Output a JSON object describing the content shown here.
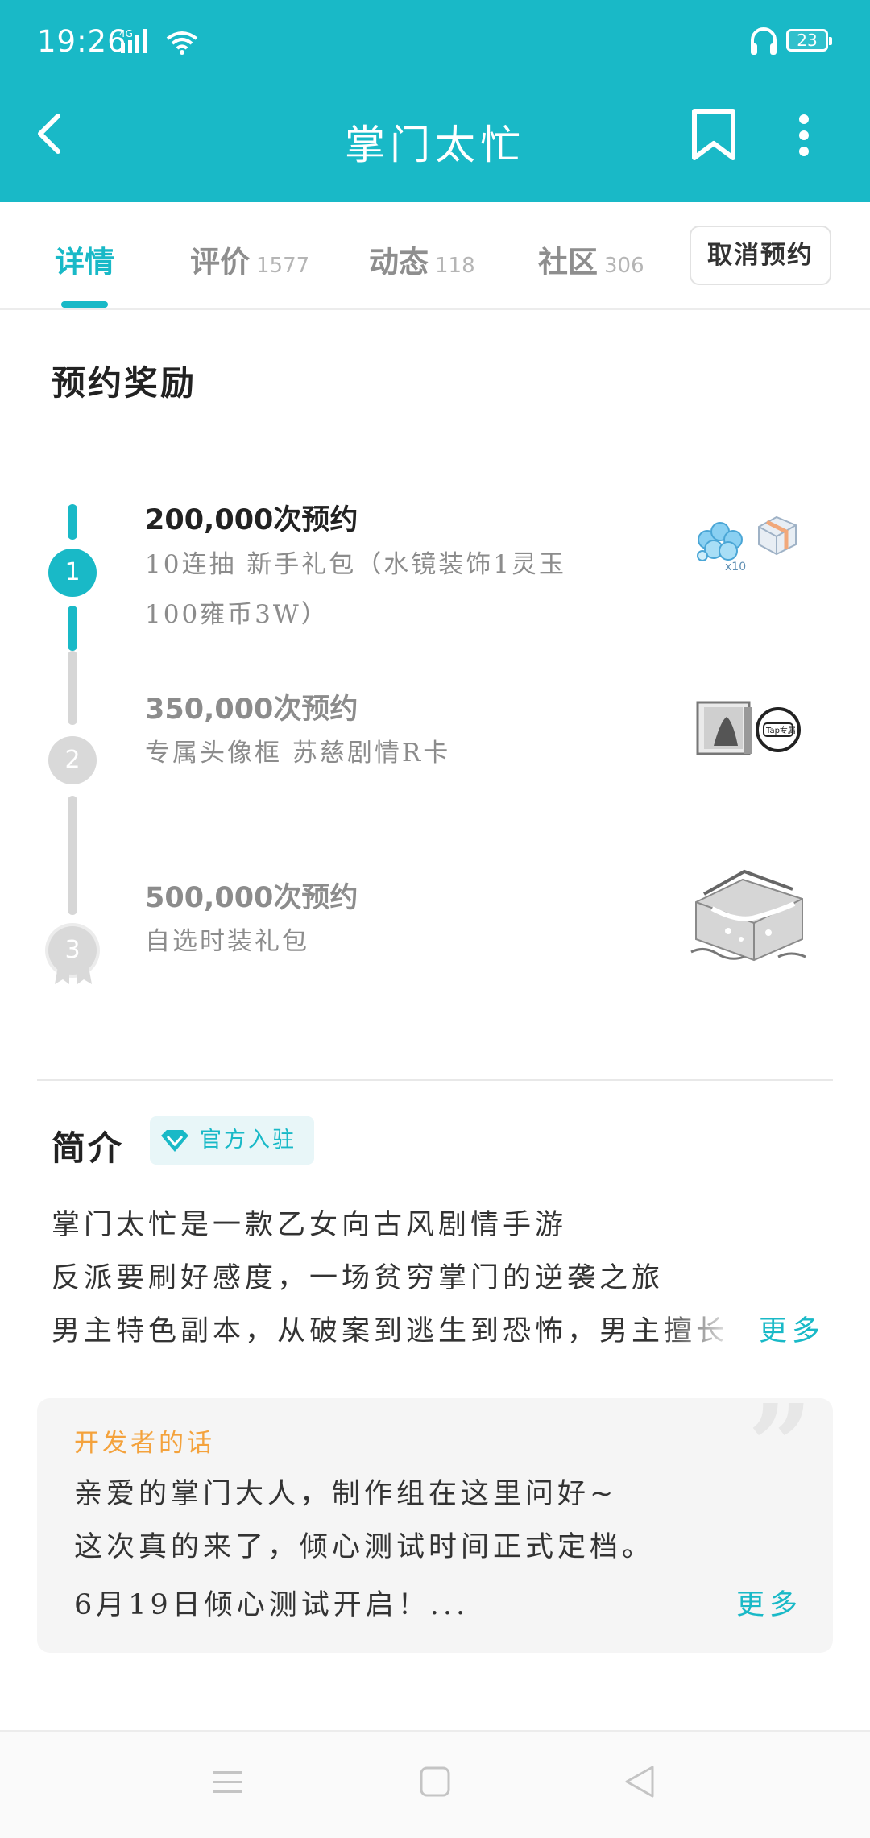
{
  "status_bar": {
    "time": "19:26",
    "network": "4G",
    "battery": "23"
  },
  "app_bar": {
    "title": "掌门太忙"
  },
  "tabs": [
    {
      "label": "详情",
      "count": ""
    },
    {
      "label": "评价",
      "count": "1577"
    },
    {
      "label": "动态",
      "count": "118"
    },
    {
      "label": "社区",
      "count": "306"
    }
  ],
  "cancel_button": "取消预约",
  "rewards": {
    "title": "预约奖励",
    "items": [
      {
        "step": "1",
        "title": "200,000次预约",
        "desc": "10连抽 新手礼包（水镜装饰1灵玉100雍币3W）",
        "status": "achieved"
      },
      {
        "step": "2",
        "title": "350,000次预约",
        "desc": "专属头像框 苏慈剧情R卡",
        "status": "locked"
      },
      {
        "step": "3",
        "title": "500,000次预约",
        "desc": "自选时装礼包",
        "status": "locked"
      }
    ],
    "badge_x10": "x10",
    "frame_label": "Tap专属"
  },
  "intro": {
    "title": "简介",
    "badge": "官方入驻",
    "lines": [
      "掌门太忙是一款乙女向古风剧情手游",
      "反派要刷好感度，一场贫穷掌门的逆袭之旅",
      "男主特色副本，从破案到逃生到恐怖，男主擅长"
    ],
    "more": "更多"
  },
  "developer_note": {
    "title": "开发者的话",
    "lines": [
      "亲爱的掌门大人，制作组在这里问好~",
      "这次真的来了，倾心测试时间正式定档。",
      "6月19日倾心测试开启！..."
    ],
    "more": "更多"
  },
  "colors": {
    "accent": "#19b9c7",
    "orange": "#f4a23c"
  }
}
